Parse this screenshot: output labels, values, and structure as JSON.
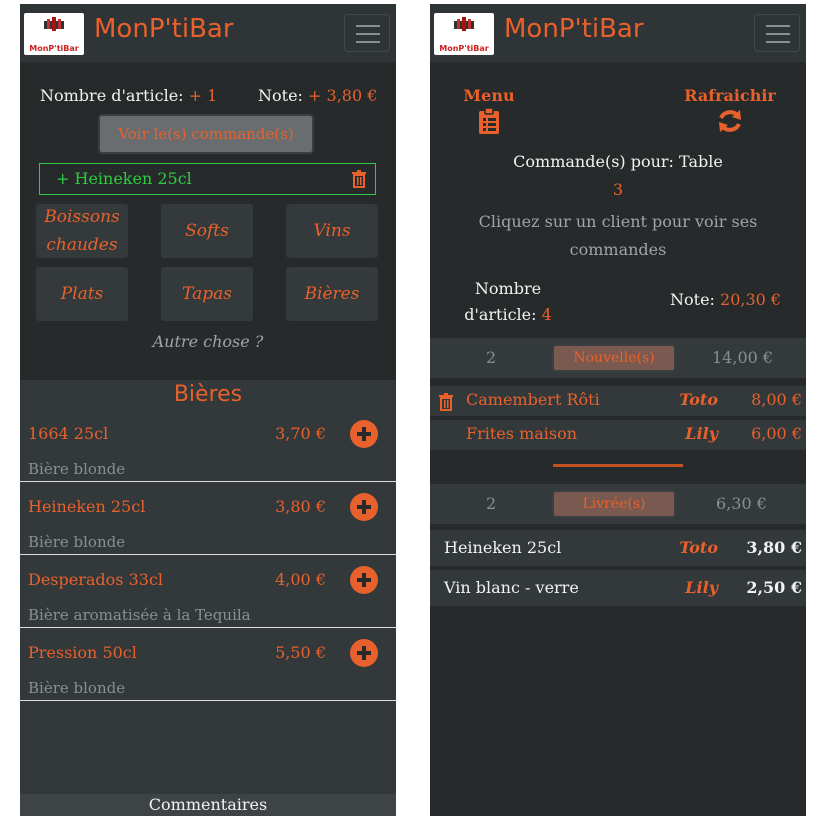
{
  "colors": {
    "accent": "#e8612c",
    "background": "#262a2b",
    "success": "#2ecc40"
  },
  "app": {
    "brand": "MonP'tiBar",
    "logo_text": "MonP'tiBar"
  },
  "left": {
    "nombre_label": "Nombre d'article:",
    "nombre_value": "+ 1",
    "note_label": "Note:",
    "note_value": "+ 3,80 €",
    "view_orders_label": "Voir le(s) commande(s)",
    "pending_item": "+ Heineken 25cl",
    "categories": [
      "Boissons chaudes",
      "Softs",
      "Vins",
      "Plats",
      "Tapas",
      "Bières"
    ],
    "other_prompt": "Autre chose ?",
    "section_title": "Bières",
    "products": [
      {
        "name": "1664 25cl",
        "price": "3,70 €",
        "desc": "Bière blonde"
      },
      {
        "name": "Heineken 25cl",
        "price": "3,80 €",
        "desc": "Bière blonde"
      },
      {
        "name": "Desperados 33cl",
        "price": "4,00 €",
        "desc": "Bière aromatisée à la Tequila"
      },
      {
        "name": "Pression 50cl",
        "price": "5,50 €",
        "desc": "Bière blonde"
      }
    ],
    "comments_label": "Commentaires"
  },
  "right": {
    "menu_label": "Menu",
    "refresh_label": "Rafraichir",
    "orders_for": "Commande(s) pour: Table",
    "table_number": "3",
    "hint": "Cliquez sur un client pour voir ses commandes",
    "nombre_label": "Nombre d'article:",
    "nombre_value": "4",
    "note_label": "Note:",
    "note_value": "20,30 €",
    "groups": [
      {
        "count": "2",
        "status": "Nouvelle(s)",
        "total": "14,00 €"
      },
      {
        "count": "2",
        "status": "Livrée(s)",
        "total": "6,30 €"
      }
    ],
    "new_items": [
      {
        "name": "Camembert Rôti",
        "client": "Toto",
        "price": "8,00 €"
      },
      {
        "name": "Frites maison",
        "client": "Lily",
        "price": "6,00 €"
      }
    ],
    "delivered_items": [
      {
        "name": "Heineken 25cl",
        "client": "Toto",
        "price": "3,80 €"
      },
      {
        "name": "Vin blanc - verre",
        "client": "Lily",
        "price": "2,50 €"
      }
    ]
  }
}
